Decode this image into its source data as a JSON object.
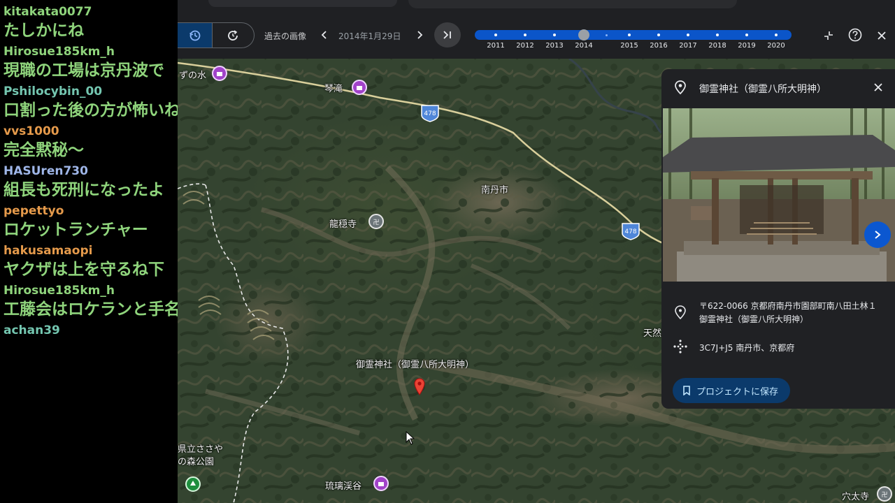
{
  "chat": {
    "messages": [
      {
        "user": "kitakata0077",
        "user_color": "#8fd47c",
        "text": "たしかにね"
      },
      {
        "user": "Hirosue185km_h",
        "user_color": "#8fd47c",
        "text": "現職の工場は京丹波で"
      },
      {
        "user": "Pshilocybin_00",
        "user_color": "#74c6b0",
        "text": "口割った後の方が怖いね"
      },
      {
        "user": "vvs1000",
        "user_color": "#e59a4b",
        "text": "完全黙秘〜"
      },
      {
        "user": "HASUren730",
        "user_color": "#9fb6e8",
        "text": "組長も死刑になったよ"
      },
      {
        "user": "pepettyo",
        "user_color": "#e59a4b",
        "text": "ロケットランチャー"
      },
      {
        "user": "hakusamaopi",
        "user_color": "#e59a4b",
        "text": "ヤクザは上を守るね下"
      },
      {
        "user": "Hirosue185km_h",
        "user_color": "#8fd47c",
        "text": "工藤会はロケランと手名"
      },
      {
        "user": "achan39",
        "user_color": "#74c6b0",
        "text": ""
      }
    ]
  },
  "toolbar": {
    "history_label": "過去の画像",
    "date": "2014年1月29日",
    "timeline_years": [
      "2011",
      "2012",
      "2013",
      "2014",
      "2015",
      "2016",
      "2017",
      "2018",
      "2019",
      "2020"
    ],
    "selected_year": "2014"
  },
  "map": {
    "labels": {
      "water": "ずの水",
      "kotaki": "琴滝",
      "route1": "478",
      "route2": "478",
      "nantan": "南丹市",
      "ryuonji": "龍穏寺",
      "shrine": "御霊神社（御霊八所大明神）",
      "tennen": "天然",
      "park": "県立ささや\nの森公園",
      "rurikeikoku": "琉璃渓谷",
      "anatauji": "穴太寺"
    }
  },
  "card": {
    "title": "御霊神社（御霊八所大明神）",
    "address": "〒622-0066 京都府南丹市園部町南八田土林１ 御霊神社（御霊八所大明神）",
    "plus_code": "3C7J+J5 南丹市、京都府",
    "save_label": "プロジェクトに保存"
  }
}
